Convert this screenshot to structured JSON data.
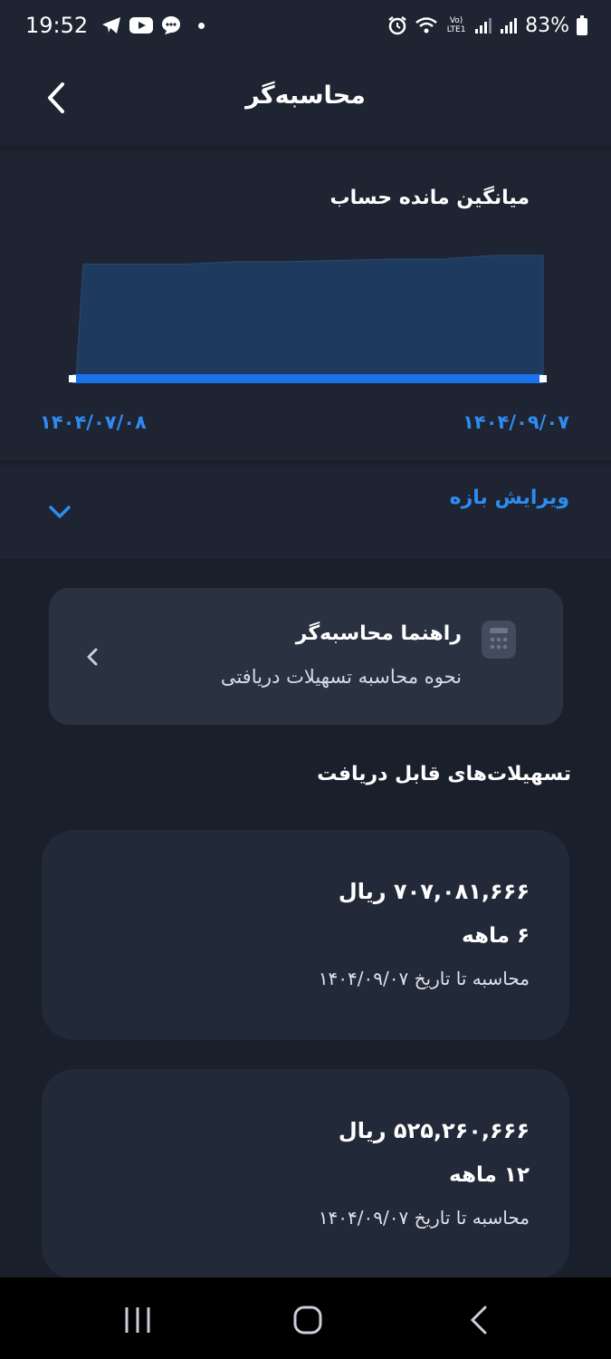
{
  "status_bar": {
    "time": "19:52",
    "battery": "83%",
    "network_label": "Vo) LTE1",
    "icons": [
      "telegram-icon",
      "youtube-icon",
      "chat-icon",
      "alarm-icon",
      "wifi-icon",
      "signal-icon",
      "battery-icon"
    ]
  },
  "header": {
    "title": "محاسبه‌گر",
    "back_icon": "chevron-left-icon"
  },
  "chart_card": {
    "title": "میانگین مانده حساب",
    "start_date": "۱۴۰۴/۰۷/۰۸",
    "end_date": "۱۴۰۴/۰۹/۰۷",
    "chart_data": {
      "type": "area",
      "title": "میانگین مانده حساب",
      "x_range": [
        "۱۴۰۴/۰۷/۰۸",
        "۱۴۰۴/۰۹/۰۷"
      ],
      "values": [
        0,
        0.93,
        0.93,
        0.93,
        0.95,
        0.95,
        0.96,
        0.97,
        0.97,
        1.0,
        1.0
      ],
      "ylim": [
        0,
        1
      ],
      "range_selection": [
        0,
        1
      ],
      "grid": false,
      "colors": {
        "area": "#1e3a5f",
        "selection_bar": "#1a73e8"
      }
    }
  },
  "edit_range": {
    "label": "ویرایش بازه",
    "icon": "chevron-down-icon"
  },
  "guide_card": {
    "title": "راهنما محاسبه‌گر",
    "subtitle": "نحوه محاسبه تسهیلات دریافتی",
    "icon": "calculator-icon"
  },
  "section": {
    "heading": "تسهیلات‌های قابل دریافت"
  },
  "loans": [
    {
      "amount": "۷۰۷,۰۸۱,۶۶۶ ریال",
      "term": "۶ ماهه",
      "note": "محاسبه تا تاریخ ۱۴۰۴/۰۹/۰۷"
    },
    {
      "amount": "۵۲۵,۲۶۰,۶۶۶ ریال",
      "term": "۱۲ ماهه",
      "note": "محاسبه تا تاریخ ۱۴۰۴/۰۹/۰۷"
    }
  ],
  "colors": {
    "background": "#1a1f2c",
    "surface": "#1e2432",
    "accent": "#2e8cf0"
  }
}
